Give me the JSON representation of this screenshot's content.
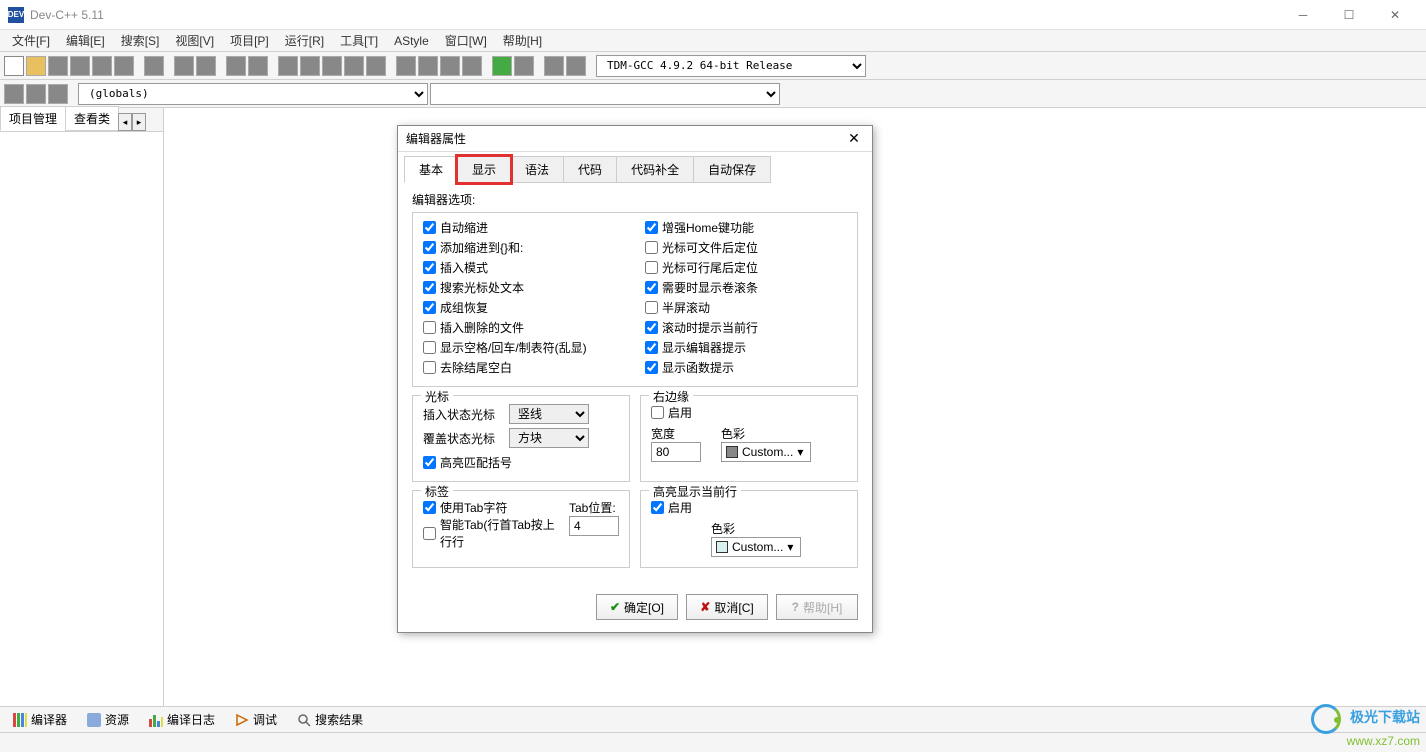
{
  "app": {
    "title": "Dev-C++ 5.11"
  },
  "menus": [
    "文件[F]",
    "编辑[E]",
    "搜索[S]",
    "视图[V]",
    "项目[P]",
    "运行[R]",
    "工具[T]",
    "AStyle",
    "窗口[W]",
    "帮助[H]"
  ],
  "toolbar": {
    "compiler_select": "TDM-GCC 4.9.2 64-bit Release",
    "globals": "(globals)"
  },
  "left_panel": {
    "tabs": [
      "项目管理",
      "查看类"
    ],
    "active": 0
  },
  "bottom_tabs": [
    "编译器",
    "资源",
    "编译日志",
    "调试",
    "搜索结果"
  ],
  "dialog": {
    "title": "编辑器属性",
    "tabs": [
      "基本",
      "显示",
      "语法",
      "代码",
      "代码补全",
      "自动保存"
    ],
    "active_tab": 0,
    "highlighted_tab": 1,
    "editor_options_label": "编辑器选项:",
    "left_checks": [
      {
        "label": "自动缩进",
        "checked": true
      },
      {
        "label": "添加缩进到{}和:",
        "checked": true
      },
      {
        "label": "插入模式",
        "checked": true
      },
      {
        "label": "搜索光标处文本",
        "checked": true
      },
      {
        "label": "成组恢复",
        "checked": true
      },
      {
        "label": "插入删除的文件",
        "checked": false
      },
      {
        "label": "显示空格/回车/制表符(乱显)",
        "checked": false
      },
      {
        "label": "去除结尾空白",
        "checked": false
      }
    ],
    "right_checks": [
      {
        "label": "增强Home键功能",
        "checked": true
      },
      {
        "label": "光标可文件后定位",
        "checked": false
      },
      {
        "label": "光标可行尾后定位",
        "checked": false
      },
      {
        "label": "需要时显示卷滚条",
        "checked": true
      },
      {
        "label": "半屏滚动",
        "checked": false
      },
      {
        "label": "滚动时提示当前行",
        "checked": true
      },
      {
        "label": "显示编辑器提示",
        "checked": true
      },
      {
        "label": "显示函数提示",
        "checked": true
      }
    ],
    "cursor": {
      "legend": "光标",
      "insert_label": "插入状态光标",
      "insert_value": "竖线",
      "overwrite_label": "覆盖状态光标",
      "overwrite_value": "方块",
      "match_brace": {
        "label": "高亮匹配括号",
        "checked": true
      }
    },
    "right_edge": {
      "legend": "右边缘",
      "enable": {
        "label": "启用",
        "checked": false
      },
      "width_label": "宽度",
      "width_value": "80",
      "color_label": "色彩",
      "color_value": "Custom..."
    },
    "tabs_group": {
      "legend": "标签",
      "use_tab": {
        "label": "使用Tab字符",
        "checked": true
      },
      "smart_tab": {
        "label": "智能Tab(行首Tab按上行行",
        "checked": false
      },
      "tab_pos_label": "Tab位置:",
      "tab_pos_value": "4"
    },
    "highlight_line": {
      "legend": "高亮显示当前行",
      "enable": {
        "label": "启用",
        "checked": true
      },
      "color_label": "色彩",
      "color_value": "Custom...",
      "color_hex": "#d8f0f0"
    },
    "buttons": {
      "ok": "确定[O]",
      "cancel": "取消[C]",
      "help": "帮助[H]"
    }
  },
  "watermark": {
    "line1": "极光下载站",
    "line2": "www.xz7.com"
  }
}
